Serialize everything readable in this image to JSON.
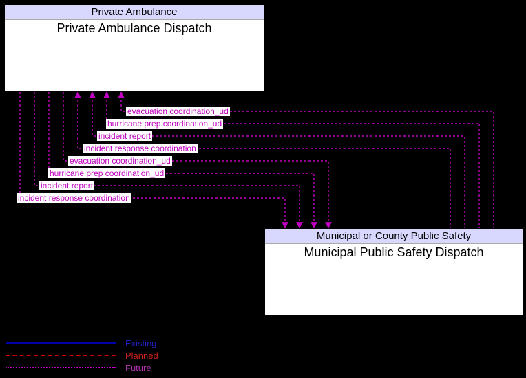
{
  "boxes": {
    "top": {
      "header": "Private Ambulance",
      "title": "Private Ambulance Dispatch"
    },
    "bottom": {
      "header": "Municipal or County Public Safety",
      "title": "Municipal Public Safety Dispatch"
    }
  },
  "flows": [
    {
      "label": "evacuation coordination_ud",
      "dir": "to_top"
    },
    {
      "label": "hurricane prep coordination_ud",
      "dir": "to_top"
    },
    {
      "label": "incident report",
      "dir": "to_top"
    },
    {
      "label": "incident response coordination",
      "dir": "to_top"
    },
    {
      "label": "evacuation coordination_ud",
      "dir": "to_bottom"
    },
    {
      "label": "hurricane prep coordination_ud",
      "dir": "to_bottom"
    },
    {
      "label": "incident report",
      "dir": "to_bottom"
    },
    {
      "label": "incident response coordination",
      "dir": "to_bottom"
    }
  ],
  "legend": {
    "existing": "Existing",
    "planned": "Planned",
    "future": "Future"
  },
  "colors": {
    "flow": "#c000c0",
    "box_header_bg": "#d8d8ff",
    "legend_existing": "#0000aa",
    "legend_planned": "#cc0000",
    "legend_future": "#c000c0"
  }
}
